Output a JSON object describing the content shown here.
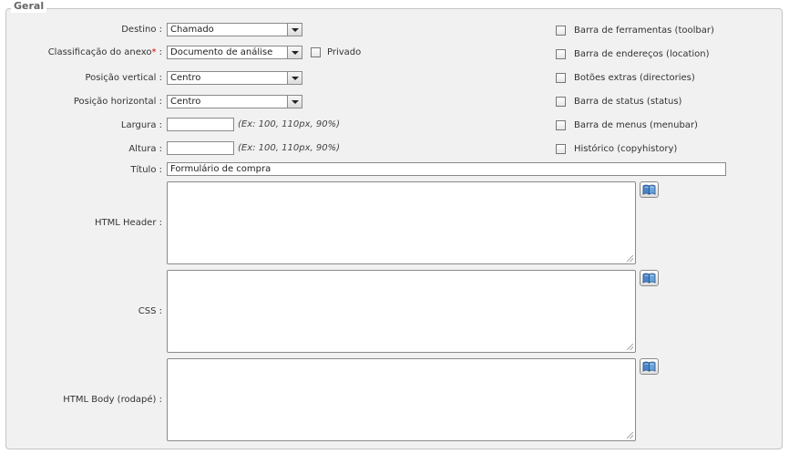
{
  "fieldset": {
    "legend": "Geral"
  },
  "form": {
    "destino": {
      "label": "Destino :",
      "value": "Chamado"
    },
    "classificacao": {
      "label": "Classificação do anexo",
      "required_mark": "*",
      "colon": " :",
      "value": "Documento de análise"
    },
    "privado": {
      "label": "Privado"
    },
    "posicao_vertical": {
      "label": "Posição vertical :",
      "value": "Centro"
    },
    "posicao_horizontal": {
      "label": "Posição horizontal :",
      "value": "Centro"
    },
    "largura": {
      "label": "Largura :",
      "value": "",
      "hint": "(Ex: 100, 110px, 90%)"
    },
    "altura": {
      "label": "Altura :",
      "value": "",
      "hint": "(Ex: 100, 110px, 90%)"
    },
    "titulo": {
      "label": "Título :",
      "value": "Formulário de compra"
    },
    "html_header": {
      "label": "HTML Header :"
    },
    "css": {
      "label": "CSS :"
    },
    "html_body": {
      "label": "HTML Body (rodapé) :"
    }
  },
  "options": [
    {
      "label": "Barra de ferramentas (toolbar)"
    },
    {
      "label": "Barra de endereços (location)"
    },
    {
      "label": "Botões extras (directories)"
    },
    {
      "label": "Barra de status (status)"
    },
    {
      "label": "Barra de menus (menubar)"
    },
    {
      "label": "Histórico (copyhistory)"
    }
  ],
  "icons": {
    "editor_button": "book-icon",
    "select_arrow": "chevron-down-icon",
    "resize": "resize-grip-icon"
  }
}
